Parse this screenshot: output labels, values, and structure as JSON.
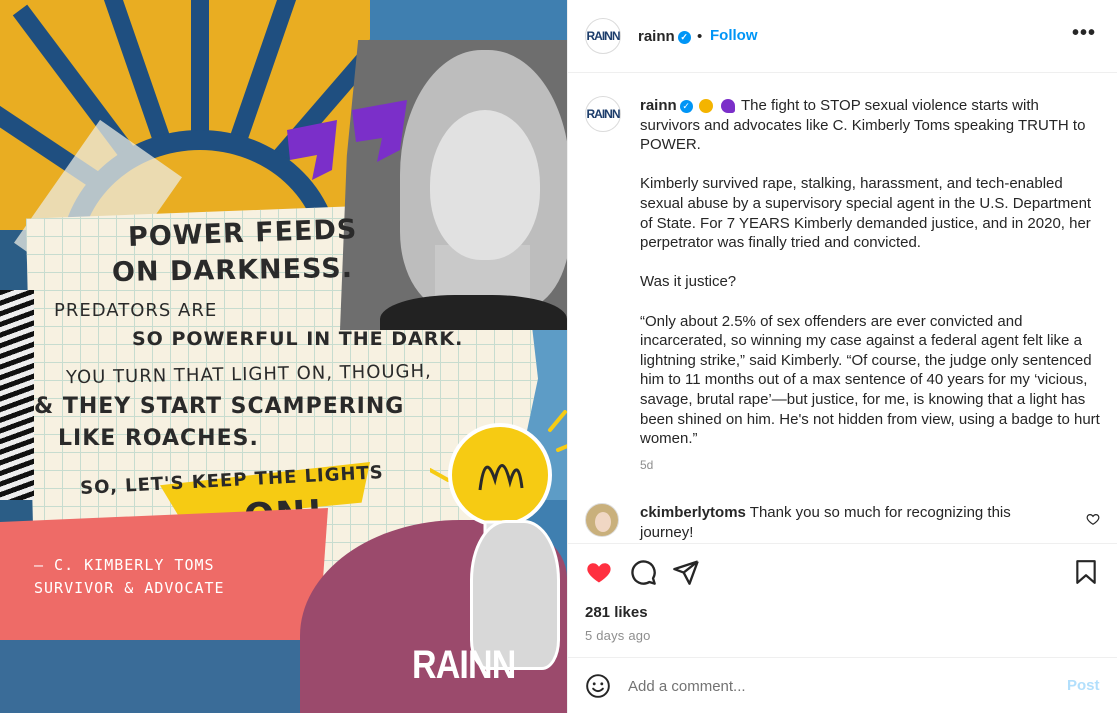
{
  "poster": {
    "line1": "POWER FEEDS",
    "line2": "ON DARKNESS.",
    "line3": "PREDATORS ARE",
    "line4": "SO POWERFUL IN THE DARK.",
    "line5": "YOU TURN THAT LIGHT ON, THOUGH,",
    "line6": "& THEY START SCAMPERING",
    "line7": "LIKE ROACHES.",
    "line8": "SO, LET'S KEEP THE LIGHTS",
    "line9": "ON!",
    "attribution1": "– C. KIMBERLY TOMS",
    "attribution2": "SURVIVOR & ADVOCATE",
    "logo": "RAINN"
  },
  "header": {
    "avatar_text": "RAINN",
    "username": "rainn",
    "separator": "•",
    "follow_label": "Follow",
    "more_label": "•••"
  },
  "caption": {
    "avatar_text": "RAINN",
    "username": "rainn",
    "p1": "The fight to STOP sexual violence starts with survivors and advocates like C. Kimberly Toms speaking TRUTH to POWER.",
    "p2": "Kimberly survived rape, stalking, harassment, and tech-enabled sexual abuse by a supervisory special agent in the U.S. Department of State. For 7 YEARS Kimberly demanded justice, and in 2020, her perpetrator was finally tried and convicted.",
    "p3": "Was it justice?",
    "p4": "“Only about 2.5% of sex offenders are ever convicted and incarcerated, so winning my case against a federal agent felt like a lightning strike,” said Kimberly. “Of course, the judge only sentenced him to 11 months out of a max sentence of 40 years for my ‘vicious, savage, brutal rape’—but justice, for me, is knowing that a light has been shined on him. He's not hidden from view, using a badge to hurt women.”",
    "age": "5d"
  },
  "comment": {
    "username": "ckimberlytoms",
    "text": "Thank you so much for recognizing this journey!"
  },
  "stats": {
    "likes": "281 likes",
    "ago": "5 days ago"
  },
  "compose": {
    "placeholder": "Add a comment...",
    "post_label": "Post"
  },
  "colors": {
    "accent": "#0095f6",
    "like": "#ff3040",
    "poster_yellow": "#e9ad22",
    "poster_pink": "#ee6b67"
  }
}
